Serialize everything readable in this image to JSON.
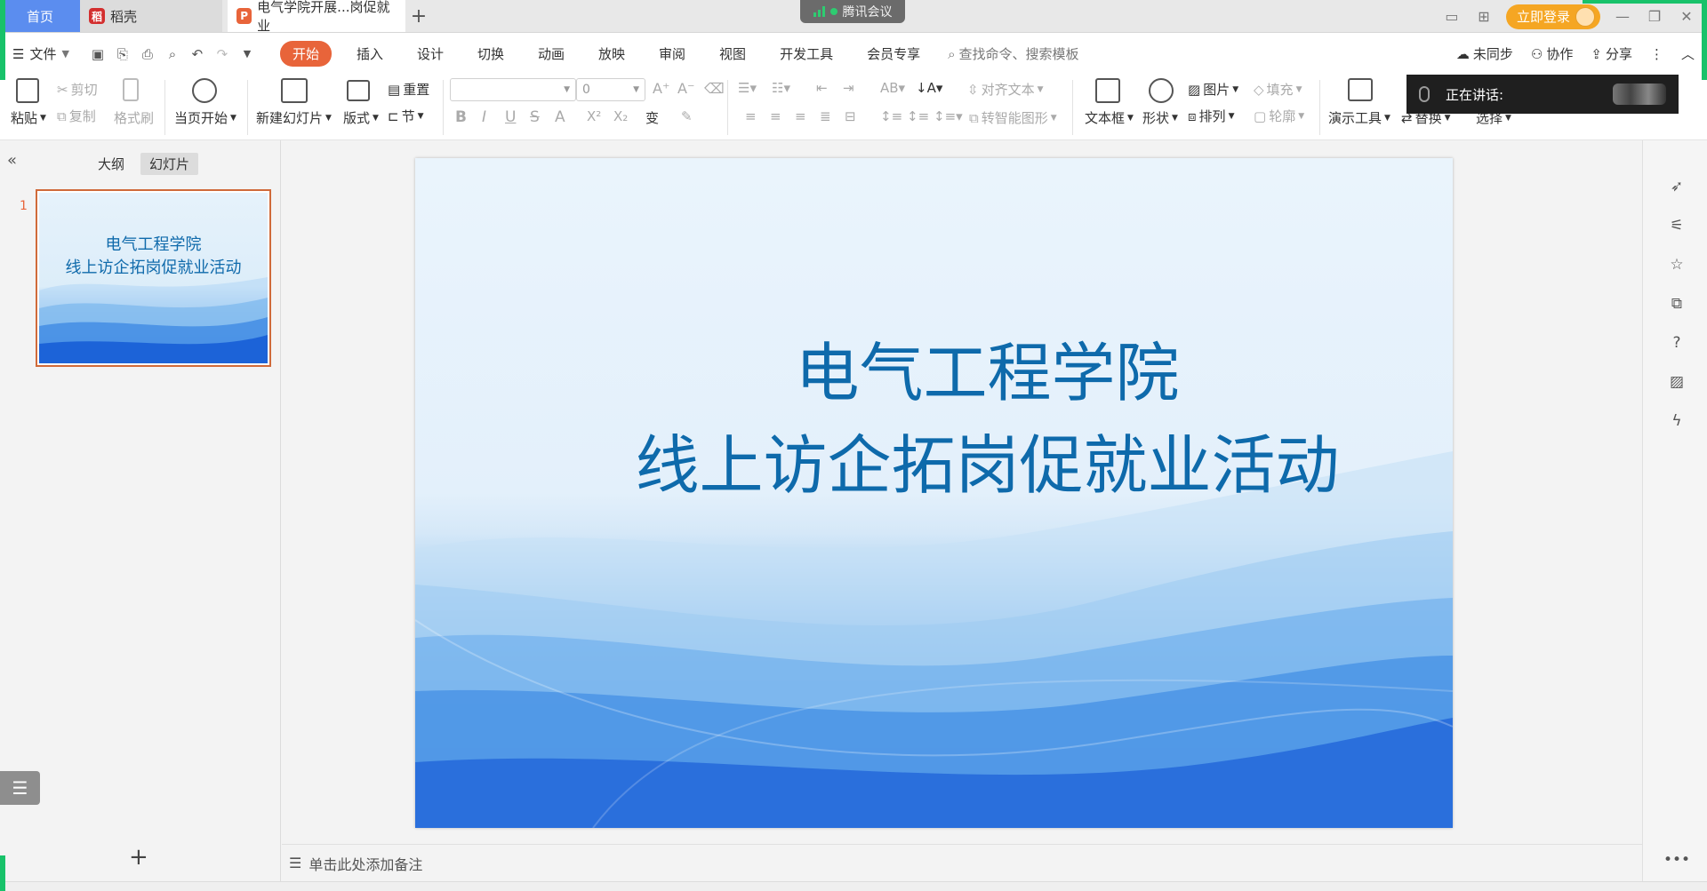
{
  "tabs": {
    "home": "首页",
    "daoke": "稻壳",
    "document": "电气学院开展...岗促就业",
    "new_tab": "+"
  },
  "meeting": {
    "app_name": "腾讯会议",
    "speaking_label": "正在讲话:"
  },
  "account": {
    "login": "立即登录"
  },
  "menu": {
    "file": "文件",
    "tabs": [
      "开始",
      "插入",
      "设计",
      "切换",
      "动画",
      "放映",
      "审阅",
      "视图",
      "开发工具",
      "会员专享"
    ],
    "active_tab": "开始",
    "search_placeholder": "查找命令、搜索模板",
    "unsynced": "未同步",
    "collaborate": "协作",
    "share": "分享"
  },
  "ribbon": {
    "paste": "粘贴",
    "cut": "剪切",
    "copy": "复制",
    "format_painter": "格式刷",
    "play_from_current": "当页开始",
    "new_slide": "新建幻灯片",
    "layout": "版式",
    "reset": "重置",
    "section": "节",
    "font_size_value": "0",
    "align_text": "对齐文本",
    "smartart": "转智能图形",
    "textbox": "文本框",
    "shape": "形状",
    "picture": "图片",
    "arrange": "排列",
    "fill": "填充",
    "outline": "轮廓",
    "presenter_tools": "演示工具",
    "replace": "替换",
    "select": "选择"
  },
  "left_pane": {
    "outline_tab": "大纲",
    "slides_tab": "幻灯片",
    "slide_number": "1",
    "thumb_line1": "电气工程学院",
    "thumb_line2": "线上访企拓岗促就业活动"
  },
  "slide": {
    "title_line1": "电气工程学院",
    "title_line2": "线上访企拓岗促就业活动"
  },
  "notes": {
    "placeholder": "单击此处添加备注"
  },
  "colors": {
    "accent": "#e8643a",
    "home_tab": "#5b8def",
    "login": "#f5a623",
    "title_text": "#0e6aab",
    "meeting_green": "#18c26a"
  }
}
